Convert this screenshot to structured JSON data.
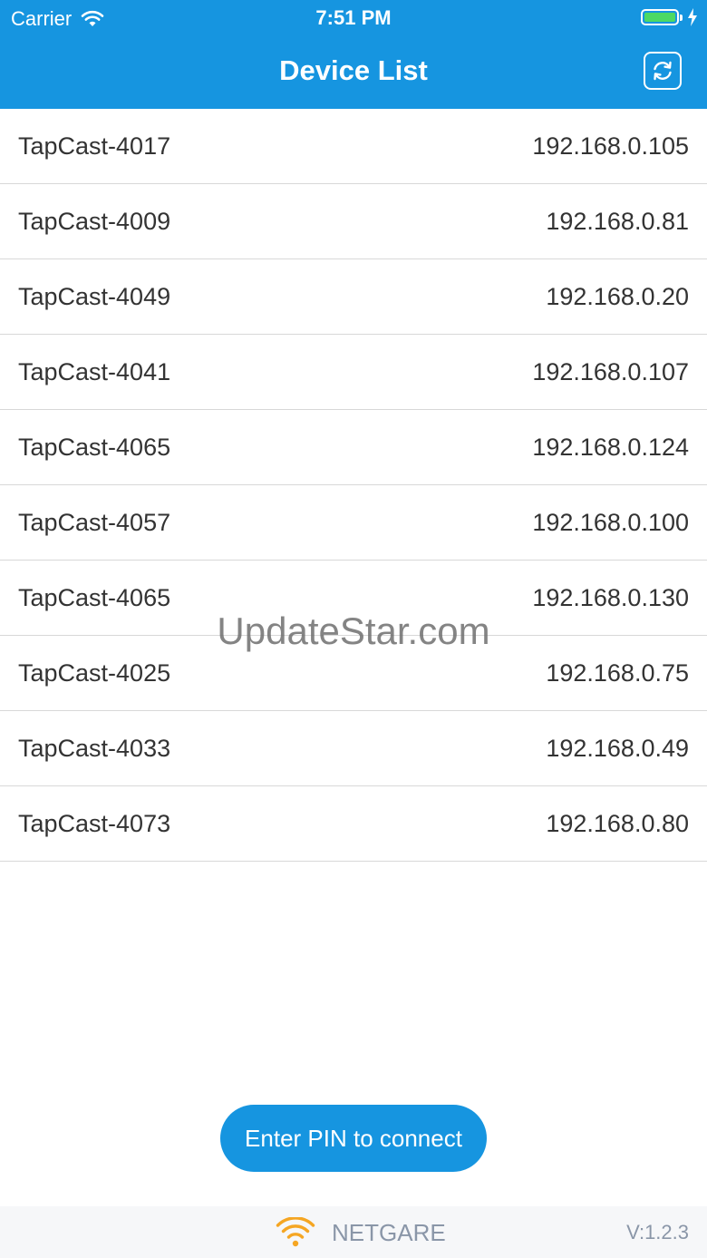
{
  "status_bar": {
    "carrier": "Carrier",
    "time": "7:51 PM",
    "battery_color": "#4CD964"
  },
  "header": {
    "title": "Device List",
    "refresh_icon": "refresh-icon",
    "background_color": "#1695E0"
  },
  "devices": [
    {
      "name": "TapCast-4017",
      "ip": "192.168.0.105"
    },
    {
      "name": "TapCast-4009",
      "ip": "192.168.0.81"
    },
    {
      "name": "TapCast-4049",
      "ip": "192.168.0.20"
    },
    {
      "name": "TapCast-4041",
      "ip": "192.168.0.107"
    },
    {
      "name": "TapCast-4065",
      "ip": "192.168.0.124"
    },
    {
      "name": "TapCast-4057",
      "ip": "192.168.0.100"
    },
    {
      "name": "TapCast-4065",
      "ip": "192.168.0.130"
    },
    {
      "name": "TapCast-4025",
      "ip": "192.168.0.75"
    },
    {
      "name": "TapCast-4033",
      "ip": "192.168.0.49"
    },
    {
      "name": "TapCast-4073",
      "ip": "192.168.0.80"
    }
  ],
  "watermark": "UpdateStar.com",
  "pin_button": {
    "label": "Enter PIN to connect"
  },
  "footer": {
    "brand": "NETGARE",
    "brand_icon": "wifi-icon",
    "brand_icon_color": "#F5A623",
    "version": "V:1.2.3"
  }
}
